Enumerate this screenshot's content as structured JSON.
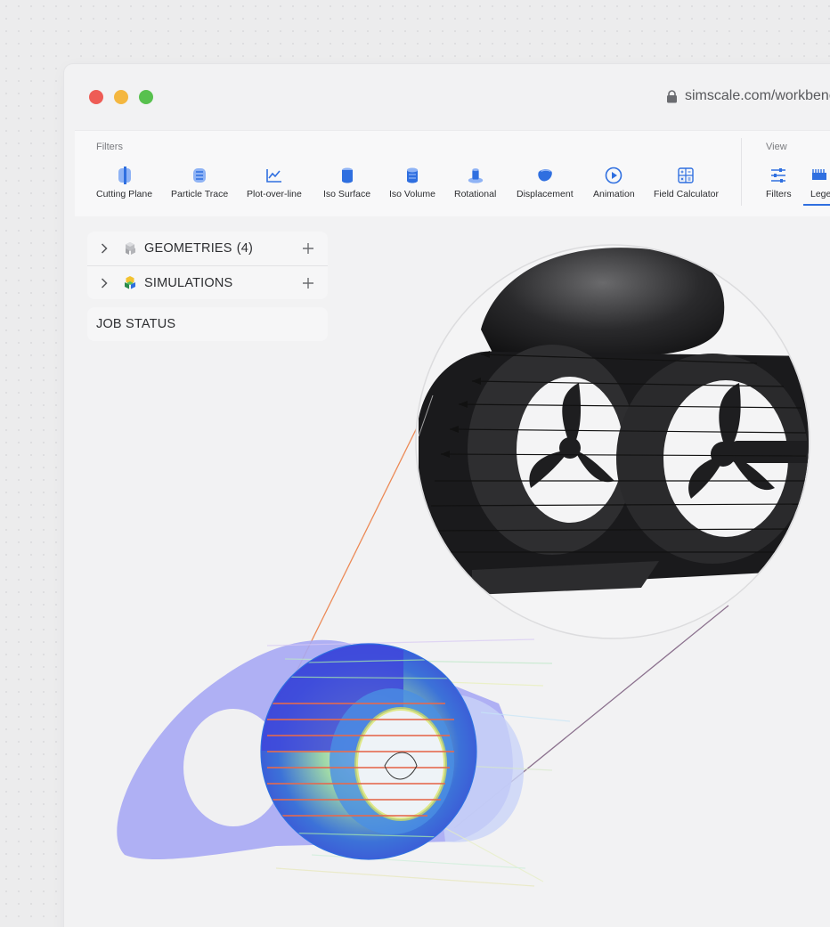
{
  "window": {
    "url": "simscale.com/workbench",
    "traffic_lights": [
      "close",
      "minimize",
      "maximize"
    ]
  },
  "toolbar": {
    "filters_group_label": "Filters",
    "view_group_label": "View",
    "tools": [
      {
        "label": "Cutting Plane",
        "icon": "cutting-plane-icon"
      },
      {
        "label": "Particle Trace",
        "icon": "particle-trace-icon"
      },
      {
        "label": "Plot-over-line",
        "icon": "plot-over-line-icon"
      },
      {
        "label": "Iso Surface",
        "icon": "iso-surface-icon"
      },
      {
        "label": "Iso Volume",
        "icon": "iso-volume-icon"
      },
      {
        "label": "Rotational",
        "icon": "rotational-icon"
      },
      {
        "label": "Displacement",
        "icon": "displacement-icon"
      },
      {
        "label": "Animation",
        "icon": "animation-play-icon"
      },
      {
        "label": "Field Calculator",
        "icon": "field-calculator-icon"
      }
    ],
    "view_tools": [
      {
        "label": "Filters",
        "icon": "filters-sliders-icon"
      },
      {
        "label": "Legend",
        "icon": "legend-icon",
        "active": true
      }
    ],
    "accent_color": "#2f6fe0"
  },
  "tree": {
    "geometries_label": "GEOMETRIES",
    "geometries_count": "(4)",
    "simulations_label": "SIMULATIONS",
    "job_status_label": "JOB STATUS"
  },
  "viewport": {
    "model": "underwater thruster with dual ducted propellers",
    "visualization": "particle trace streamlines over ducted thruster, with zoomed detail inset"
  }
}
